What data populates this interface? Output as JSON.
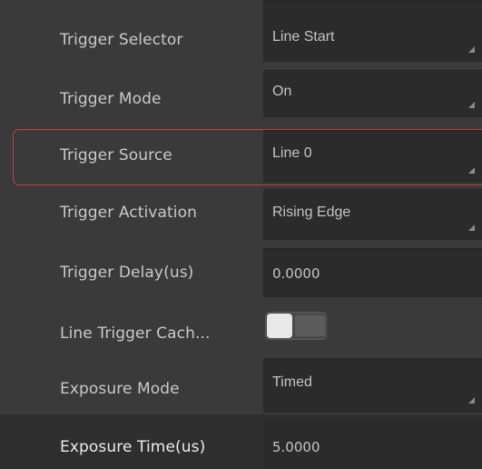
{
  "properties": [
    {
      "label": "Trigger Selector",
      "value": "Line Start",
      "type": "dropdown"
    },
    {
      "label": "Trigger Mode",
      "value": "On",
      "type": "dropdown"
    },
    {
      "label": "Trigger Source",
      "value": "Line 0",
      "type": "dropdown"
    },
    {
      "label": "Trigger Activation",
      "value": "Rising Edge",
      "type": "dropdown"
    },
    {
      "label": "Trigger Delay(us)",
      "value": "0.0000",
      "type": "number"
    },
    {
      "label": "Line Trigger Cach...",
      "value": false,
      "type": "toggle"
    },
    {
      "label": "Exposure Mode",
      "value": "Timed",
      "type": "dropdown"
    },
    {
      "label": "Exposure Time(us)",
      "value": "5.0000",
      "type": "number"
    }
  ],
  "colors": {
    "highlight_border": "#d33a3a",
    "panel_bg": "#3a3a3a",
    "field_bg": "#2b2b2b"
  },
  "icons": {
    "dropdown_grip": "resize-grip-icon",
    "toggle_off": "toggle-switch-icon"
  }
}
